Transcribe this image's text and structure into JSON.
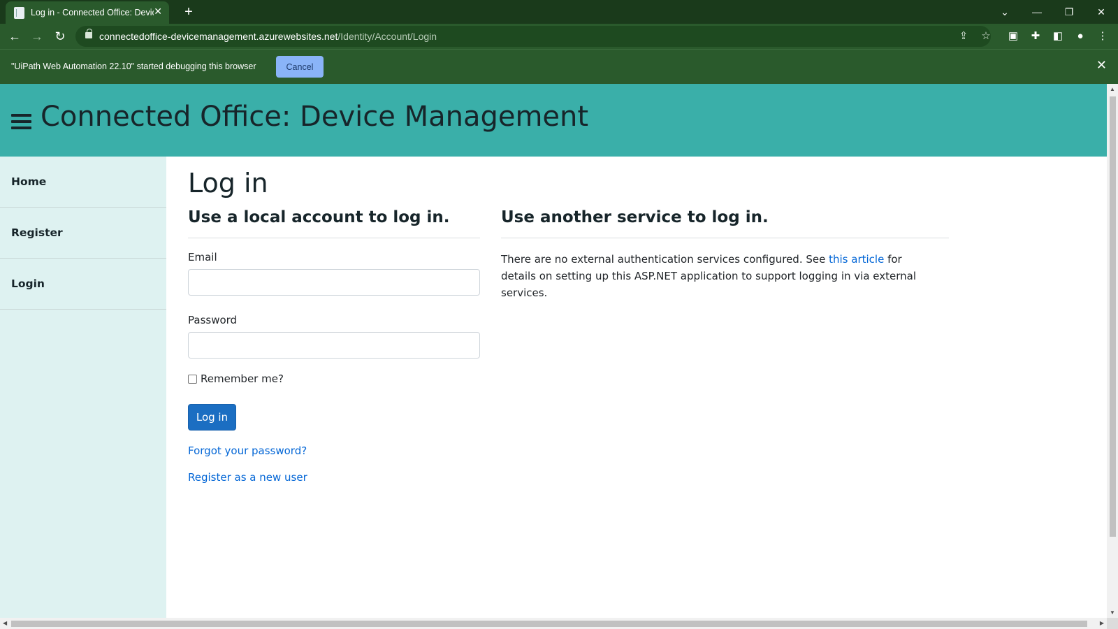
{
  "browser": {
    "tab_title": "Log in - Connected Office: Device Management",
    "tab_close": "✕",
    "new_tab": "+",
    "url_domain": "connectedoffice-devicemanagement.azurewebsites.net",
    "url_path": "/Identity/Account/Login",
    "back": "←",
    "forward": "→",
    "reload": "↻",
    "window_controls": {
      "tab_search": "⌄",
      "minimize": "—",
      "restore": "❐",
      "close": "✕"
    }
  },
  "infobar": {
    "message": "\"UiPath Web Automation 22.10\" started debugging this browser",
    "cancel_label": "Cancel",
    "close": "✕"
  },
  "app": {
    "title": "Connected Office: Device Management"
  },
  "sidebar": {
    "items": [
      {
        "label": "Home"
      },
      {
        "label": "Register"
      },
      {
        "label": "Login"
      }
    ]
  },
  "main": {
    "heading": "Log in",
    "local": {
      "heading": "Use a local account to log in.",
      "email_label": "Email",
      "email_value": "",
      "password_label": "Password",
      "password_value": "",
      "remember_label": "Remember me?",
      "remember_checked": false,
      "login_button": "Log in",
      "forgot_link": "Forgot your password?",
      "register_link": "Register as a new user"
    },
    "external": {
      "heading": "Use another service to log in.",
      "text_before": "There are no external authentication services configured. See ",
      "link_text": "this article",
      "text_after": " for details on setting up this ASP.NET application to support logging in via external services."
    }
  },
  "colors": {
    "header_bg": "#3aafa9",
    "sidebar_bg": "#def2f1",
    "text_dark": "#17252a",
    "primary_button": "#1b6ec2",
    "link": "#0366d6",
    "chrome_dark": "#1a3a1b",
    "chrome_toolbar": "#2a5a2c",
    "infobar_button": "#8ab4f8"
  }
}
